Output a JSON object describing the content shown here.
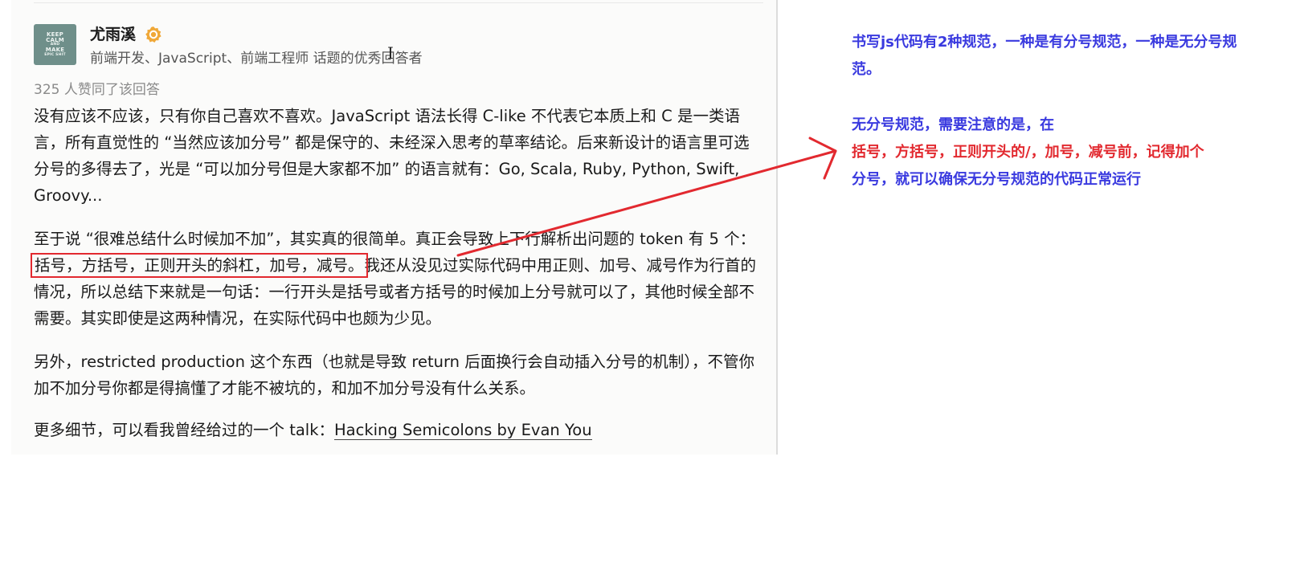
{
  "answer": {
    "avatar_lines": [
      "KEEP",
      "CALM",
      "AND",
      "MAKE",
      "EPIC SHIT"
    ],
    "author": "尤雨溪",
    "headline": "前端开发、JavaScript、前端工程师 话题的优秀回答者",
    "votes": "325 人赞同了该回答",
    "p1": "没有应该不应该，只有你自己喜欢不喜欢。JavaScript 语法长得 C-like 不代表它本质上和 C 是一类语言，所有直觉性的 “当然应该加分号” 都是保守的、未经深入思考的草率结论。后来新设计的语言里可选分号的多得去了，光是 “可以加分号但是大家都不加” 的语言就有：Go, Scala, Ruby, Python, Swift, Groovy...",
    "p2_before": "至于说 “很难总结什么时候加不加”，其实真的很简单。真正会导致上下行解析出问题的 token 有 5 个：",
    "p2_highlight": "括号，方括号，正则开头的斜杠，加号，减号。",
    "p2_after": "我还从没见过实际代码中用正则、加号、减号作为行首的情况，所以总结下来就是一句话：一行开头是括号或者方括号的时候加上分号就可以了，其他时候全部不需要。其实即使是这两种情况，在实际代码中也颇为少见。",
    "p3": "另外，restricted production 这个东西（也就是导致 return 后面换行会自动插入分号的机制），不管你加不加分号你都是得搞懂了才能不被坑的，和加不加分号没有什么关系。",
    "p4_prefix": "更多细节，可以看我曾经给过的一个 talk：",
    "p4_link": "Hacking Semicolons by Evan You"
  },
  "notes": {
    "note1": "书写js代码有2种规范，一种是有分号规范，一种是无分号规范。",
    "note2_intro": "无分号规范，需要注意的是，在",
    "note2_red": "括号，方括号，正则开头的/，加号，减号前，记得加个",
    "note2_end": "分号，就可以确保无分号规范的代码正常运行"
  },
  "colors": {
    "annotation_red": "#e2292f",
    "annotation_blue": "#3a3adf",
    "verify_badge": "#f0a838"
  },
  "icons": {
    "verify": "verified-badge-icon",
    "cursor": "text-cursor-icon",
    "arrow": "annotation-arrow"
  }
}
